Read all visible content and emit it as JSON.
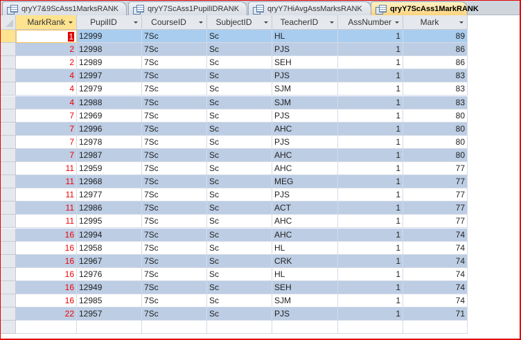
{
  "tabs": [
    {
      "label": "qryY7&9ScAss1MarksRANK",
      "active": false
    },
    {
      "label": "qryY7ScAss1PupilIDRANK",
      "active": false
    },
    {
      "label": "qryY7HiAvgAssMarksRANK",
      "active": false
    },
    {
      "label": "qryY7ScAss1MarkRANK",
      "active": true
    }
  ],
  "columns": [
    "MarkRank",
    "PupilID",
    "CourseID",
    "SubjectID",
    "TeacherID",
    "AssNumber",
    "Mark"
  ],
  "rows": [
    [
      "1",
      "12999",
      "7Sc",
      "Sc",
      "HL",
      "1",
      "89"
    ],
    [
      "2",
      "12998",
      "7Sc",
      "Sc",
      "PJS",
      "1",
      "86"
    ],
    [
      "2",
      "12989",
      "7Sc",
      "Sc",
      "SEH",
      "1",
      "86"
    ],
    [
      "4",
      "12997",
      "7Sc",
      "Sc",
      "PJS",
      "1",
      "83"
    ],
    [
      "4",
      "12979",
      "7Sc",
      "Sc",
      "SJM",
      "1",
      "83"
    ],
    [
      "4",
      "12988",
      "7Sc",
      "Sc",
      "SJM",
      "1",
      "83"
    ],
    [
      "7",
      "12969",
      "7Sc",
      "Sc",
      "PJS",
      "1",
      "80"
    ],
    [
      "7",
      "12996",
      "7Sc",
      "Sc",
      "AHC",
      "1",
      "80"
    ],
    [
      "7",
      "12978",
      "7Sc",
      "Sc",
      "PJS",
      "1",
      "80"
    ],
    [
      "7",
      "12987",
      "7Sc",
      "Sc",
      "AHC",
      "1",
      "80"
    ],
    [
      "11",
      "12959",
      "7Sc",
      "Sc",
      "AHC",
      "1",
      "77"
    ],
    [
      "11",
      "12968",
      "7Sc",
      "Sc",
      "MEG",
      "1",
      "77"
    ],
    [
      "11",
      "12977",
      "7Sc",
      "Sc",
      "PJS",
      "1",
      "77"
    ],
    [
      "11",
      "12986",
      "7Sc",
      "Sc",
      "ACT",
      "1",
      "77"
    ],
    [
      "11",
      "12995",
      "7Sc",
      "Sc",
      "AHC",
      "1",
      "77"
    ],
    [
      "16",
      "12994",
      "7Sc",
      "Sc",
      "AHC",
      "1",
      "74"
    ],
    [
      "16",
      "12958",
      "7Sc",
      "Sc",
      "HL",
      "1",
      "74"
    ],
    [
      "16",
      "12967",
      "7Sc",
      "Sc",
      "CRK",
      "1",
      "74"
    ],
    [
      "16",
      "12976",
      "7Sc",
      "Sc",
      "HL",
      "1",
      "74"
    ],
    [
      "16",
      "12949",
      "7Sc",
      "Sc",
      "SEH",
      "1",
      "74"
    ],
    [
      "16",
      "12985",
      "7Sc",
      "Sc",
      "SJM",
      "1",
      "74"
    ],
    [
      "22",
      "12957",
      "7Sc",
      "Sc",
      "PJS",
      "1",
      "71"
    ]
  ],
  "colors": {
    "rank_text": "#f00000",
    "alt_row": "#bccde4",
    "current_row": "#a9cdef",
    "active_tab": "#fcd27a"
  }
}
